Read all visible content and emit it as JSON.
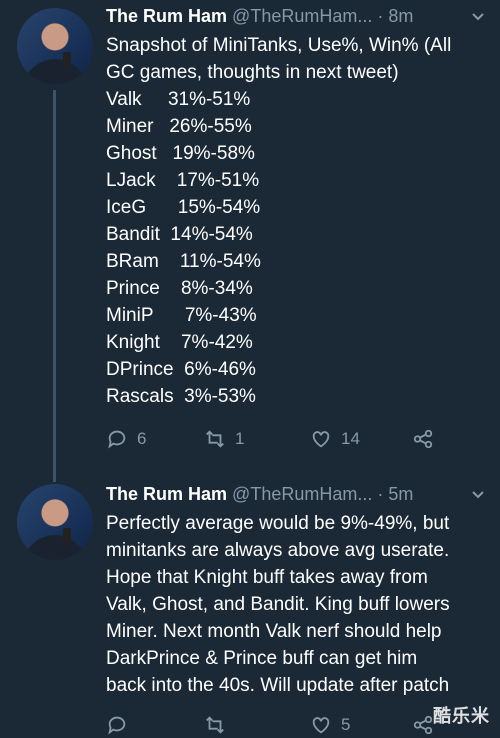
{
  "tweets": [
    {
      "name": "The Rum Ham",
      "handle": "@TheRumHam...",
      "time": "· 8m",
      "body": [
        "Snapshot of MiniTanks, Use%, Win% (All",
        "GC games, thoughts in next tweet)",
        "Valk     31%-51%",
        "Miner   26%-55%",
        "Ghost   19%-58%",
        "LJack    17%-51%",
        "IceG      15%-54%",
        "Bandit  14%-54%",
        "BRam    11%-54%",
        "Prince    8%-34%",
        "MiniP      7%-43%",
        "Knight    7%-42%",
        "DPrince  6%-46%",
        "Rascals  3%-53%"
      ],
      "actions": {
        "replies": "6",
        "retweets": "1",
        "likes": "14"
      }
    },
    {
      "name": "The Rum Ham",
      "handle": "@TheRumHam...",
      "time": "· 5m",
      "body": [
        "Perfectly average would be 9%-49%, but",
        "minitanks are always above avg userate.",
        "Hope that Knight buff takes away from",
        "Valk, Ghost, and Bandit. King buff lowers",
        "Miner. Next month Valk nerf should help",
        "DarkPrince & Prince buff can get him",
        "back into the 40s. Will update after patch"
      ],
      "actions": {
        "replies": "",
        "retweets": "",
        "likes": "5"
      }
    }
  ],
  "watermark": "酷乐米",
  "icons": [
    "reply-icon",
    "retweet-icon",
    "like-icon",
    "share-icon",
    "chevron-down-icon"
  ]
}
